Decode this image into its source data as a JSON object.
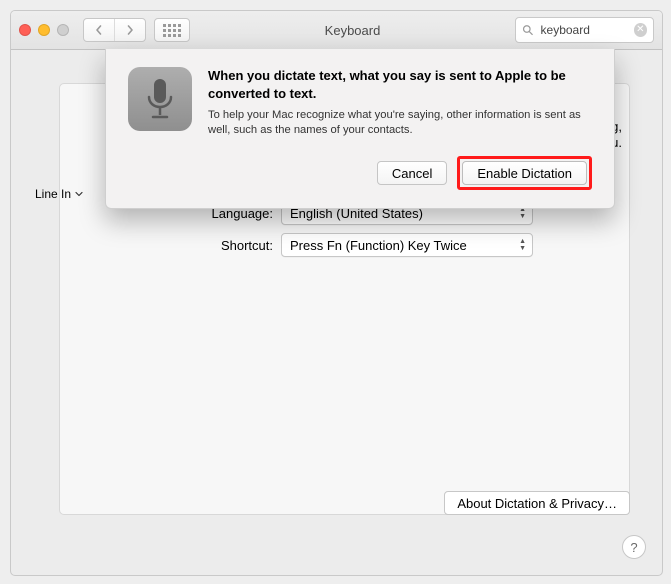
{
  "window": {
    "title": "Keyboard"
  },
  "search": {
    "value": "keyboard"
  },
  "sheet": {
    "heading": "When you dictate text, what you say is sent to Apple to be converted to text.",
    "body": "To help your Mac recognize what you're saying, other information is sent as well, such as the names of your contacts.",
    "cancel": "Cancel",
    "enable": "Enable Dictation"
  },
  "background": {
    "frag1": "ng,",
    "frag2": "enu.",
    "line_in": "Line In",
    "language_label": "Language:",
    "language_value": "English (United States)",
    "shortcut_label": "Shortcut:",
    "shortcut_value": "Press Fn (Function) Key Twice",
    "about": "About Dictation & Privacy…"
  }
}
